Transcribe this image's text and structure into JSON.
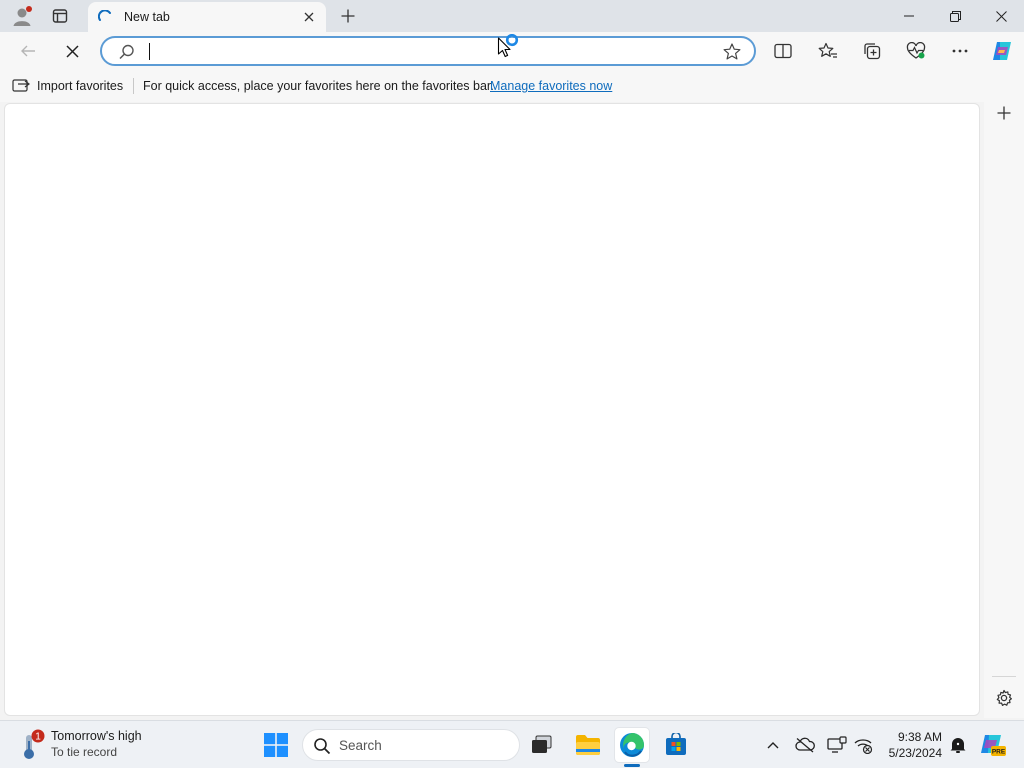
{
  "browser": {
    "tab": {
      "title": "New tab"
    },
    "omnibox": {
      "value": "",
      "placeholder": ""
    },
    "favorites_bar": {
      "import_label": "Import favorites",
      "message": "For quick access, place your favorites here on the favorites bar.",
      "link_label": "Manage favorites now"
    }
  },
  "taskbar": {
    "weather": {
      "title": "Tomorrow's high",
      "subtitle": "To tie record",
      "badge": "1"
    },
    "search_label": "Search",
    "clock": {
      "time": "9:38 AM",
      "date": "5/23/2024"
    }
  },
  "icons": {
    "profile": "profile-icon",
    "tab_actions": "tab-actions-icon",
    "loading": "loading-spinner-icon",
    "close": "close-icon",
    "plus": "plus-icon",
    "minimize": "minimize-icon",
    "restore": "restore-icon",
    "back": "back-arrow-icon",
    "stop": "stop-icon",
    "search": "search-icon",
    "star": "star-icon",
    "split_screen": "split-screen-icon",
    "favorites": "favorites-icon",
    "collections": "collections-icon",
    "performance": "heartbeat-icon",
    "more": "more-icon",
    "copilot": "copilot-icon",
    "settings": "gear-icon"
  },
  "colors": {
    "accent": "#0f6cbd",
    "omnibox_border": "#5b9bd5",
    "notification_red": "#c42b1c"
  }
}
